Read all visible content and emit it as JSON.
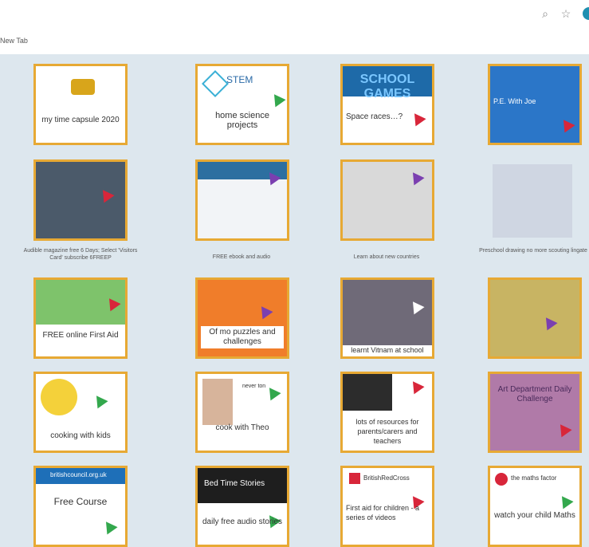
{
  "browser": {
    "tab_title": "New Tab",
    "search_icon": "search-icon",
    "star_icon": "star-icon"
  },
  "tiles": {
    "t1": {
      "text": "my time capsule 2020"
    },
    "t2": {
      "logo": "STEM",
      "text": "home science projects"
    },
    "t3": {
      "header": "SCHOOL GAMES",
      "text": "Space races…?"
    },
    "t4": {
      "text": "P.E. With Joe"
    },
    "t5": {
      "caption": "Audible magazine free 6 Days; Select 'Visitors Card' subscribe 6FREEP"
    },
    "t6": {
      "caption": "FREE ebook and audio"
    },
    "t7": {
      "caption": "Learn about new countries"
    },
    "t8": {
      "caption": "Preschool drawing no more scouting lingate"
    },
    "t9": {
      "text": "FREE online First Aid"
    },
    "t10": {
      "text": "Of mo puzzles and challenges"
    },
    "t11": {
      "text": "learnt Vitnam at school"
    },
    "t12": {
      "text": ""
    },
    "t13": {
      "text": "cooking with kids"
    },
    "t14": {
      "text": "cook with Theo",
      "small": "never ton"
    },
    "t15": {
      "text": "lots of resources for parents/carers and teachers"
    },
    "t16": {
      "text": "Art Department Daily Challenge"
    },
    "t17": {
      "header": "britishcouncil.org.uk",
      "text": "Free Course"
    },
    "t18": {
      "header": "Bed Time Stories",
      "text": "daily free audio stories"
    },
    "t19": {
      "header": "BritishRedCross",
      "text": "First aid for children - a series of videos"
    },
    "t20": {
      "header": "the maths factor",
      "text": "watch your child Maths"
    }
  }
}
